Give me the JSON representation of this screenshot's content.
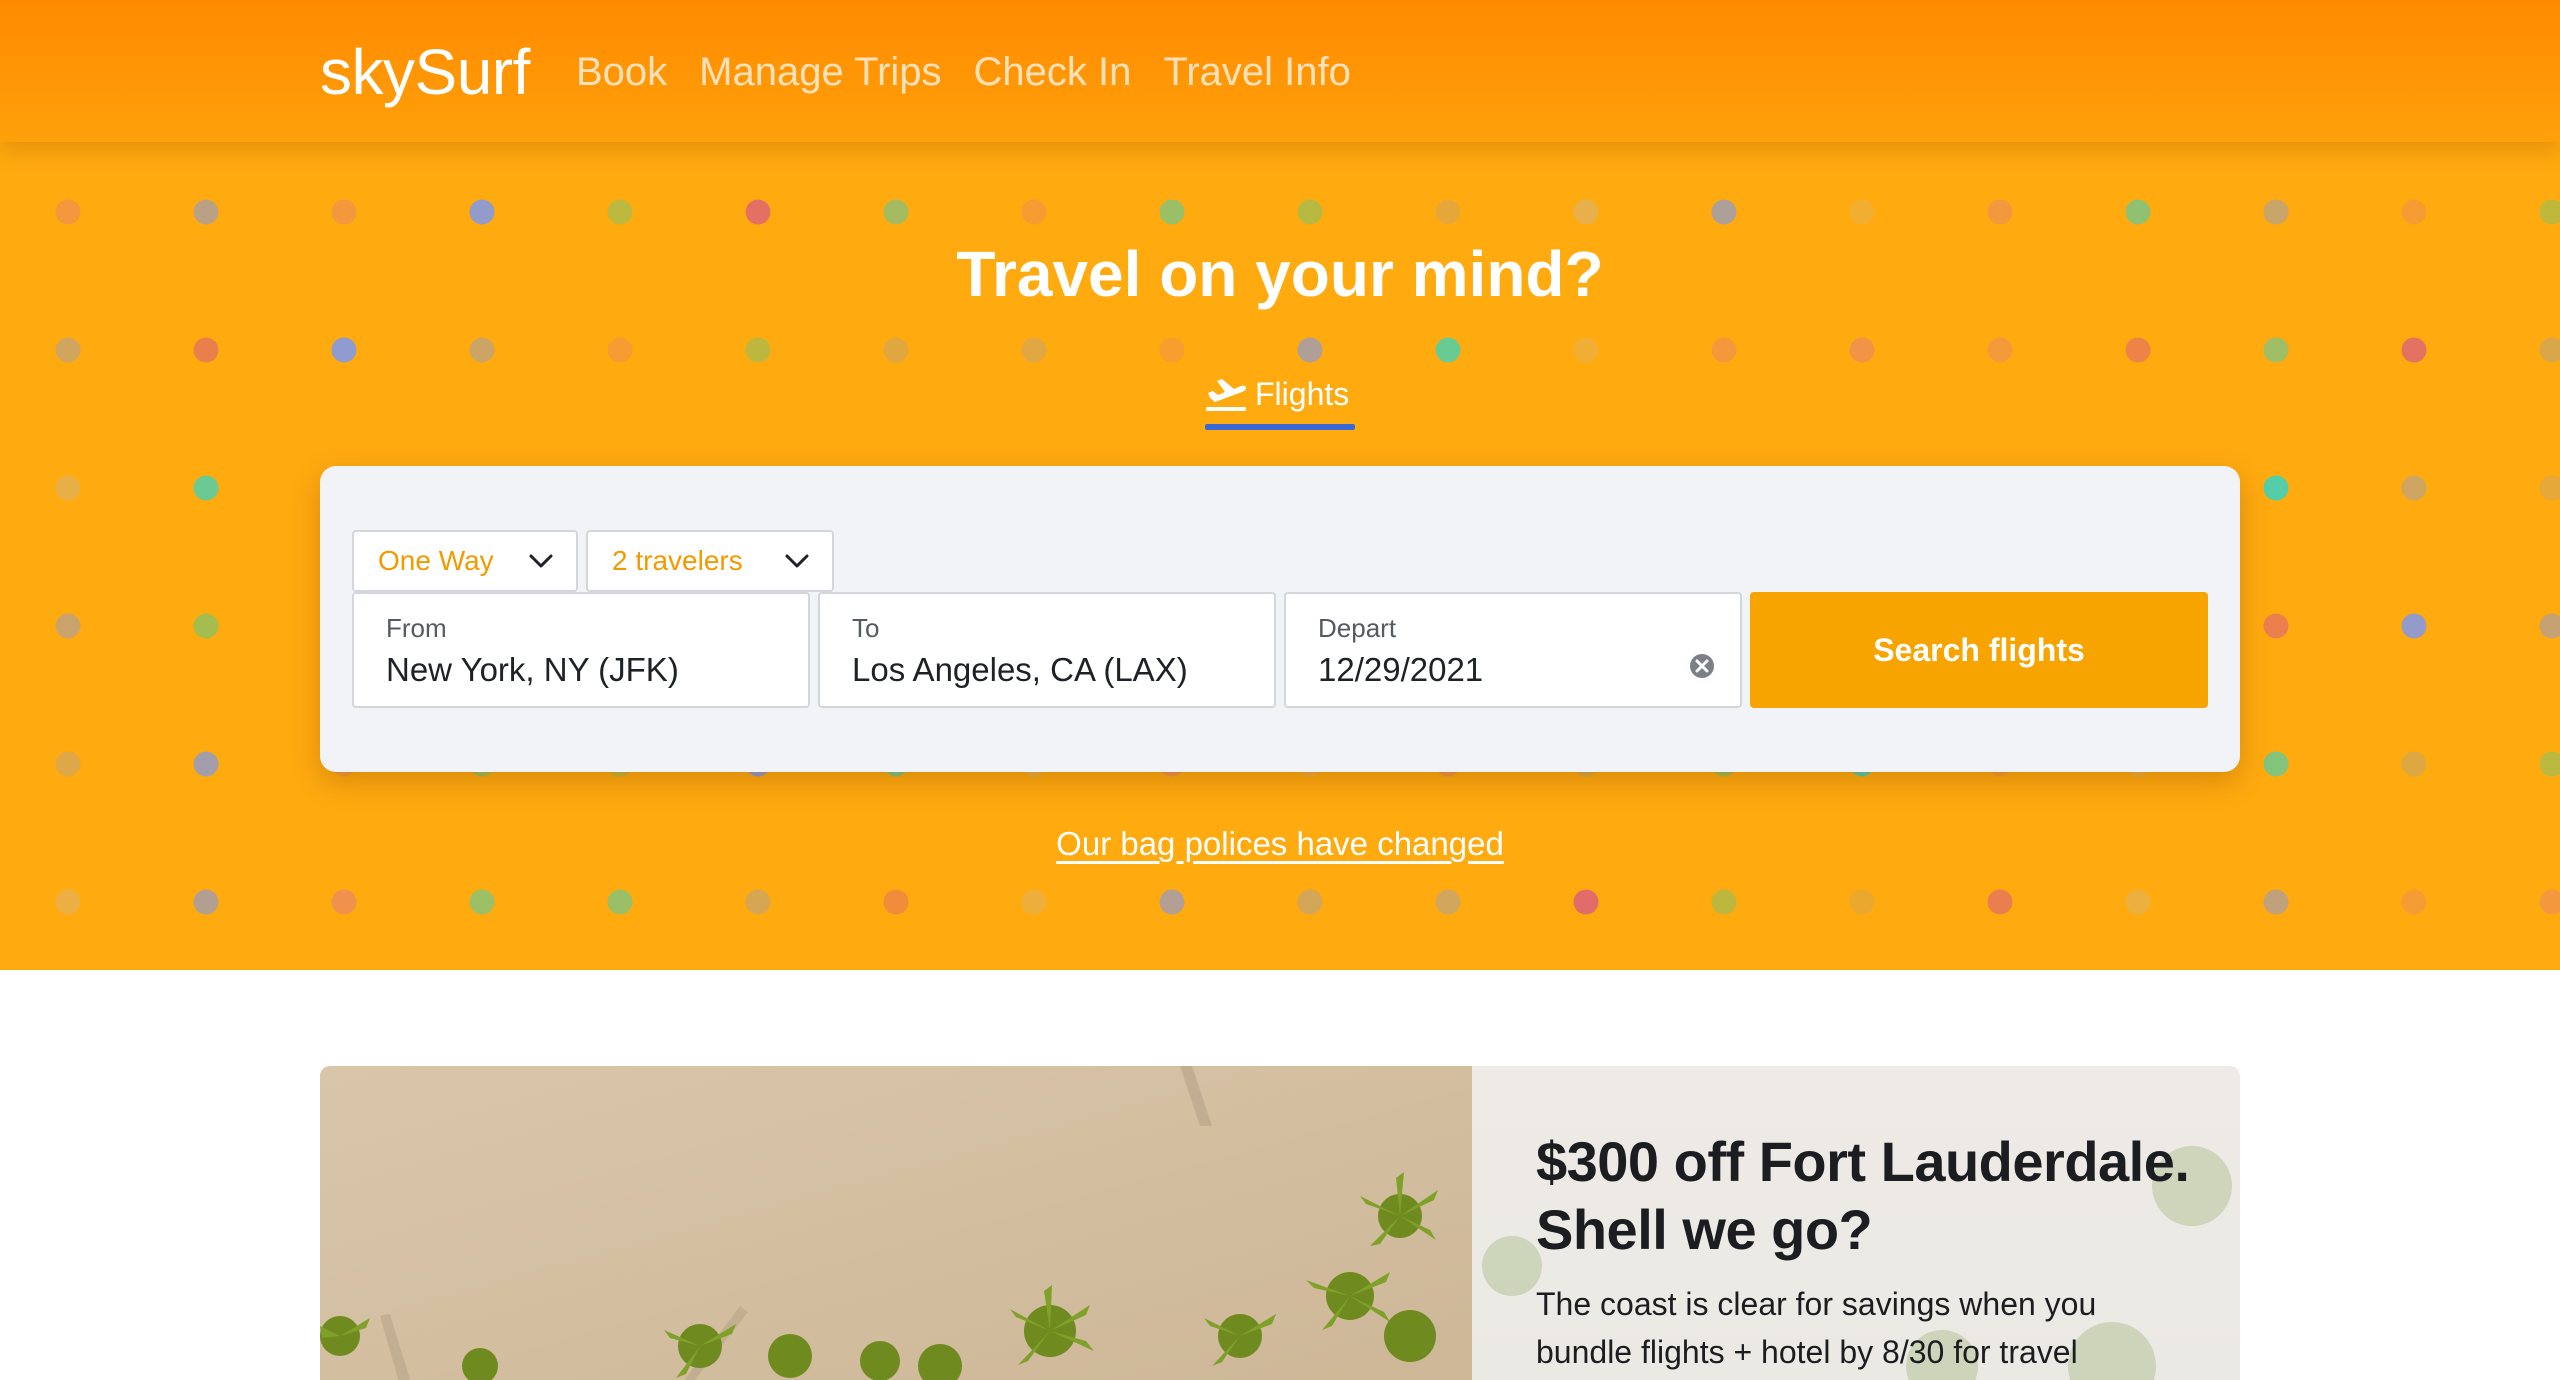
{
  "header": {
    "brand": "skySurf",
    "nav": [
      "Book",
      "Manage Trips",
      "Check In",
      "Travel Info"
    ]
  },
  "hero": {
    "title": "Travel on your mind?",
    "tab_label": "Flights",
    "tab_icon": "airplane-takeoff-icon"
  },
  "search": {
    "trip_type": "One Way",
    "travelers": "2 travelers",
    "from_label": "From",
    "from_value": "New York, NY (JFK)",
    "to_label": "To",
    "to_value": "Los Angeles, CA (LAX)",
    "depart_label": "Depart",
    "depart_value": "12/29/2021",
    "submit_label": "Search flights"
  },
  "bag_link": "Our bag polices have changed",
  "promo": {
    "heading": "$300 off Fort Lauderdale. Shell we go?",
    "body": "The coast is clear for savings when you bundle flights + hotel by 8/30 for travel"
  },
  "colors": {
    "header": "#ff8a00",
    "hero": "#ffaa0f",
    "accent": "#f7a300",
    "tab_underline": "#3a67d6"
  }
}
